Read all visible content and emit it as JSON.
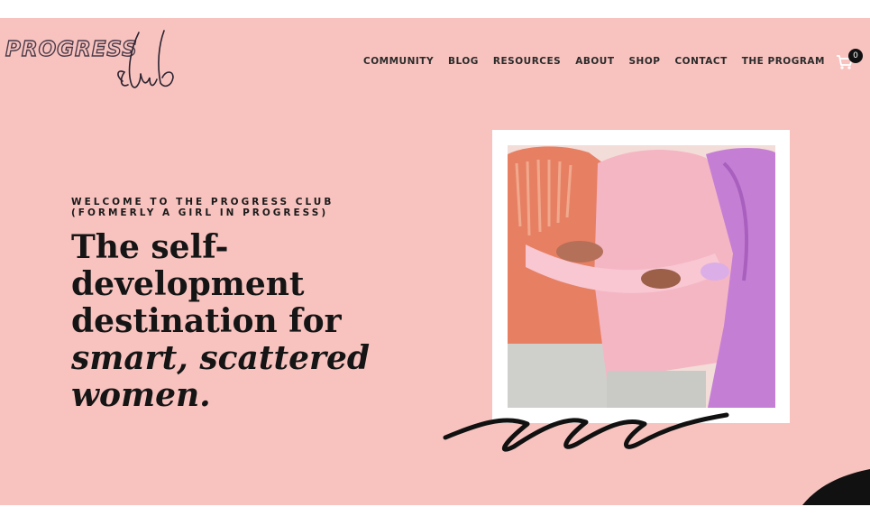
{
  "brand": {
    "logo_word": "PROGRESS",
    "logo_script": "club"
  },
  "nav": {
    "items": [
      "COMMUNITY",
      "BLOG",
      "RESOURCES",
      "ABOUT",
      "SHOP",
      "CONTACT",
      "THE PROGRAM"
    ],
    "cart_count": "0"
  },
  "hero": {
    "eyebrow_line1": "WELCOME TO THE PROGRESS CLUB",
    "eyebrow_line2": "(FORMERLY A GIRL IN PROGRESS)",
    "headline_line1": "The self-",
    "headline_line2": "development",
    "headline_line3": "destination for",
    "headline_italic1": "smart, scattered",
    "headline_italic2": "women."
  },
  "colors": {
    "background": "#f8c3bf",
    "text": "#151515",
    "frame": "#ffffff"
  }
}
